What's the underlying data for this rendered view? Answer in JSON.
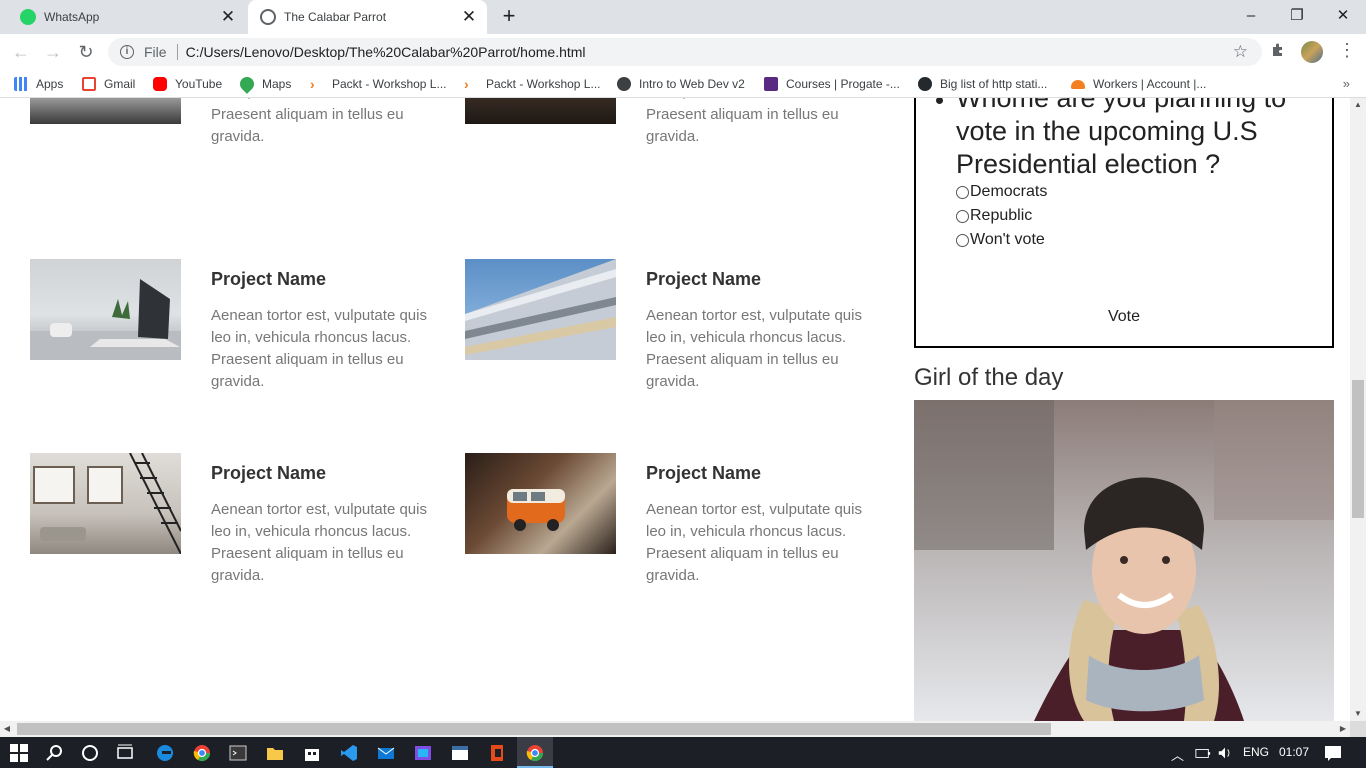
{
  "tabs": [
    {
      "title": "WhatsApp",
      "close": "✕"
    },
    {
      "title": "The Calabar Parrot",
      "close": "✕"
    }
  ],
  "newtab": "+",
  "window_controls": {
    "minimize": "–",
    "maximize": "❐",
    "close": "✕"
  },
  "nav": {
    "back": "←",
    "forward": "→",
    "reload": "↻"
  },
  "address": {
    "info": "i",
    "scheme": "File",
    "url": "C:/Users/Lenovo/Desktop/The%20Calabar%20Parrot/home.html",
    "star": "☆"
  },
  "bookmarks": [
    {
      "label": "Apps",
      "color": "#4285f4"
    },
    {
      "label": "Gmail",
      "color": "#ea4335"
    },
    {
      "label": "YouTube",
      "color": "#ff0000"
    },
    {
      "label": "Maps",
      "color": "#34a853"
    },
    {
      "label": "Packt - Workshop L...",
      "color": "#f47a20"
    },
    {
      "label": "Packt - Workshop L...",
      "color": "#f47a20"
    },
    {
      "label": "Intro to Web Dev v2",
      "color": "#3c4043"
    },
    {
      "label": "Courses | Progate -...",
      "color": "#5a2a82"
    },
    {
      "label": "Big list of http stati...",
      "color": "#24292e"
    },
    {
      "label": "Workers | Account |...",
      "color": "#f38020"
    }
  ],
  "bookmarks_more": "»",
  "projects": {
    "top_partial_desc": "leo in, vehicula rhoncus lacus. Praesent aliquam in tellus eu gravida.",
    "items": [
      {
        "title": "Project Name",
        "desc": "Aenean tortor est, vulputate quis leo in, vehicula rhoncus lacus. Praesent aliquam in tellus eu gravida."
      },
      {
        "title": "Project Name",
        "desc": "Aenean tortor est, vulputate quis leo in, vehicula rhoncus lacus. Praesent aliquam in tellus eu gravida."
      },
      {
        "title": "Project Name",
        "desc": "Aenean tortor est, vulputate quis leo in, vehicula rhoncus lacus. Praesent aliquam in tellus eu gravida."
      },
      {
        "title": "Project Name",
        "desc": "Aenean tortor est, vulputate quis leo in, vehicula rhoncus lacus. Praesent aliquam in tellus eu gravida."
      }
    ]
  },
  "poll": {
    "question": "Whome are you planning to vote in the upcoming U.S Presidential election ?",
    "options": [
      "Democrats",
      "Republic",
      "Won't vote"
    ],
    "vote_label": "Vote"
  },
  "girl_of_the_day": {
    "title": "Girl of the day"
  },
  "taskbar": {
    "lang": "ENG",
    "time": "01:07"
  }
}
